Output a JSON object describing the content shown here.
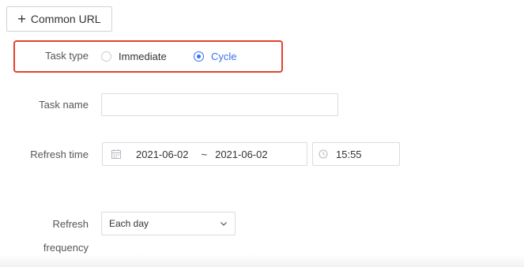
{
  "toolbar": {
    "add_button_icon": "plus-icon",
    "add_button_label": "Common URL"
  },
  "form": {
    "task_type": {
      "label": "Task type",
      "options": [
        {
          "label": "Immediate",
          "selected": false
        },
        {
          "label": "Cycle",
          "selected": true
        }
      ]
    },
    "task_name": {
      "label": "Task name",
      "value": "",
      "placeholder": ""
    },
    "refresh_time": {
      "label": "Refresh time",
      "calendar_icon": "calendar-icon",
      "start_date": "2021-06-02",
      "separator": "~",
      "end_date": "2021-06-02",
      "clock_icon": "clock-icon",
      "time": "15:55"
    },
    "refresh_frequency": {
      "label_line1": "Refresh",
      "label_line2": "frequency",
      "selected": "Each day",
      "dropdown_icon": "chevron-down-icon"
    }
  },
  "colors": {
    "accent": "#3a6ff0",
    "highlight_border": "#e0432f",
    "border": "#d9dce1"
  }
}
